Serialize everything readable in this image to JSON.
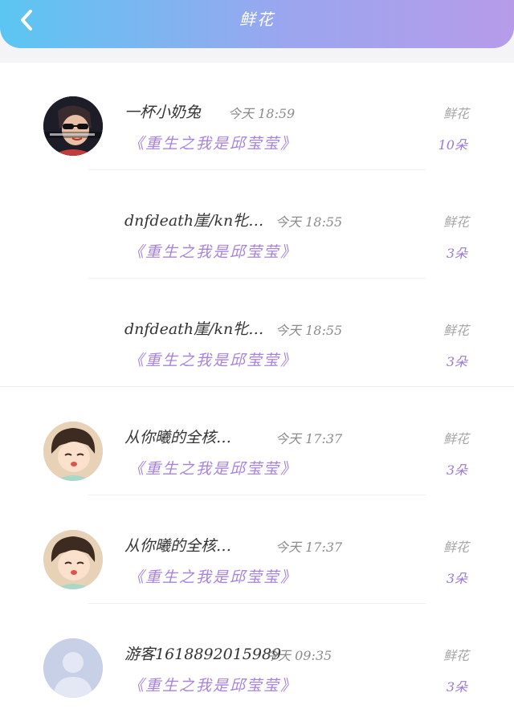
{
  "header": {
    "title": "鲜花",
    "back_icon": "chevron-left-icon",
    "colors": [
      "#5bc6f2",
      "#b79be9"
    ]
  },
  "items": [
    {
      "name": "一杯小奶兔",
      "time": "今天 18:59",
      "type": "鲜花",
      "book": "《重生之我是邱莹莹》",
      "count": "10朵",
      "avatar": "sunglasses-character"
    },
    {
      "name": "dnfdeath崖/kn牝…",
      "time": "今天 18:55",
      "type": "鲜花",
      "book": "《重生之我是邱莹莹》",
      "count": "3朵",
      "avatar": "none"
    },
    {
      "name": "dnfdeath崖/kn牝…",
      "time": "今天 18:55",
      "type": "鲜花",
      "book": "《重生之我是邱莹莹》",
      "count": "3朵",
      "avatar": "none"
    },
    {
      "name": "从你曦的全核…",
      "time": "今天 17:37",
      "type": "鲜花",
      "book": "《重生之我是邱莹莹》",
      "count": "3朵",
      "avatar": "anime-child"
    },
    {
      "name": "从你曦的全核…",
      "time": "今天 17:37",
      "type": "鲜花",
      "book": "《重生之我是邱莹莹》",
      "count": "3朵",
      "avatar": "anime-child"
    },
    {
      "name": "游客1618892015989",
      "time": "今天 09:35",
      "type": "鲜花",
      "book": "《重生之我是邱莹莹》",
      "count": "3朵",
      "avatar": "default-user"
    }
  ]
}
